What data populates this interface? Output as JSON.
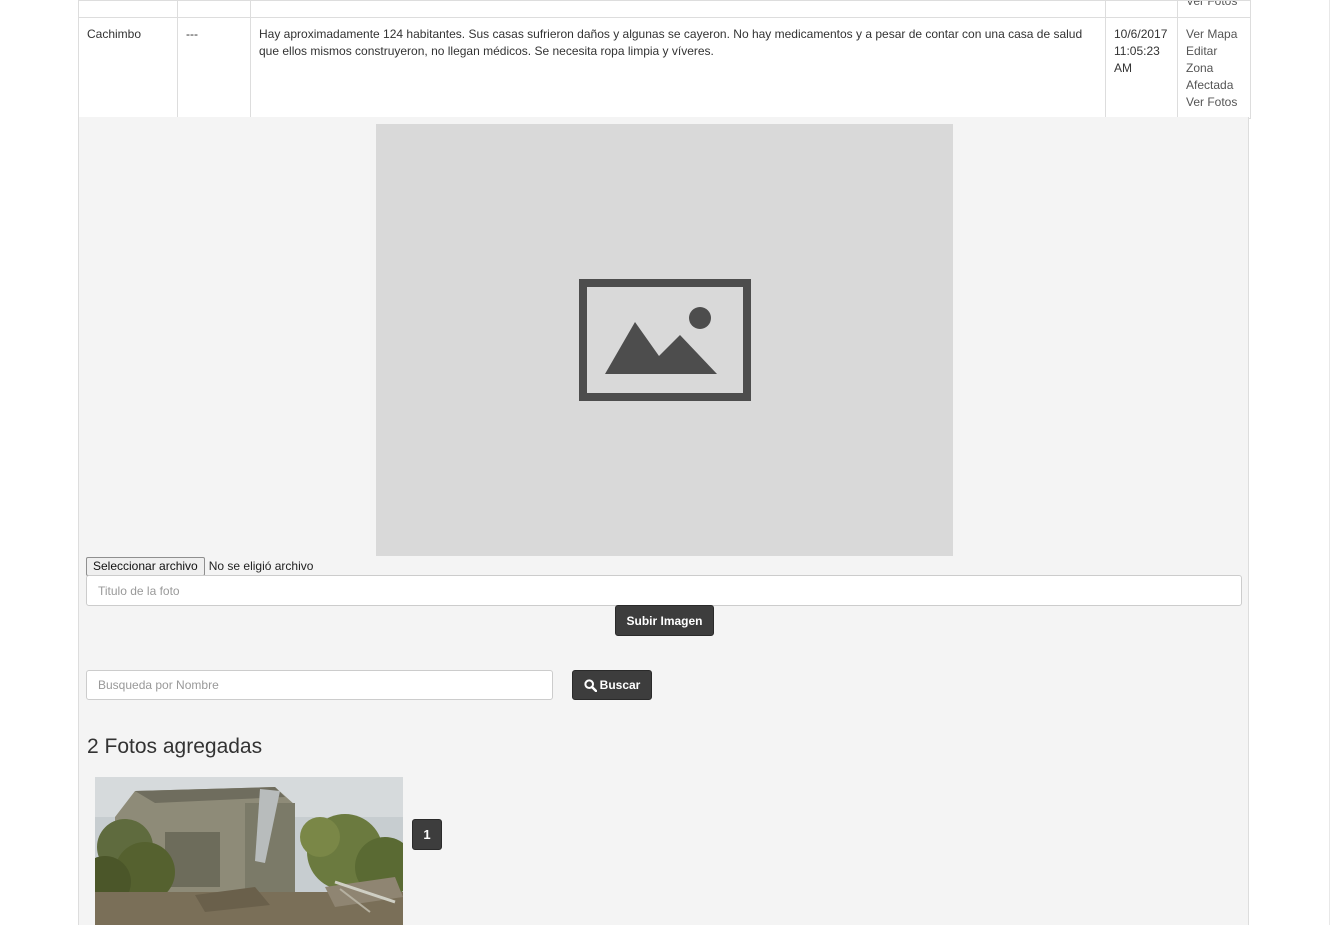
{
  "table": {
    "prev_row": {
      "actions_last": "Ver Fotos"
    },
    "row": {
      "name": "Cachimbo",
      "code": "---",
      "description": "Hay aproximadamente 124 habitantes. Sus casas sufrieron daños y algunas se cayeron. No hay medicamentos y a pesar de contar con una casa de salud que ellos mismos construyeron, no llegan médicos. Se necesita ropa limpia y víveres.",
      "date_line1": "10/6/2017",
      "date_line2": "11:05:23",
      "date_line3": "AM",
      "action_map": "Ver Mapa",
      "action_edit_1": "Editar",
      "action_edit_2": "Zona",
      "action_edit_3": "Afectada",
      "action_photos": "Ver Fotos"
    }
  },
  "upload": {
    "placeholder_icon": "image-placeholder-icon",
    "file_button": "Seleccionar archivo",
    "file_status": "No se eligió archivo",
    "title_placeholder": "Titulo de la foto",
    "submit": "Subir Imagen"
  },
  "search": {
    "placeholder": "Busqueda por Nombre",
    "button": "Buscar",
    "button_icon": "search-icon"
  },
  "gallery": {
    "count_title": "2 Fotos agregadas",
    "page": "1"
  },
  "colors": {
    "panel_bg": "#f4f4f4",
    "placeholder_bg": "#d9d9d9",
    "button_dark": "#3d3d3d",
    "icon_gray": "#4d4d4d"
  }
}
